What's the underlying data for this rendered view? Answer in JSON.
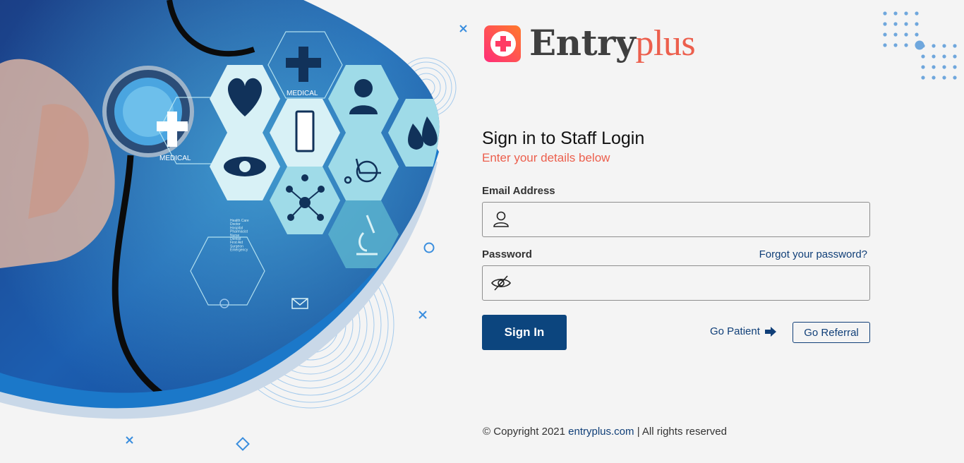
{
  "brand": {
    "name_part1": "Entry",
    "name_part2": "plus",
    "colors": {
      "primary": "#0c457e",
      "accent": "#ec5f4d",
      "logo_gradient": [
        "#ff2d7a",
        "#ff7a2b"
      ]
    }
  },
  "hero": {
    "hex_labels": {
      "medical_top": "MEDICAL",
      "medical_left": "MEDICAL"
    },
    "hex_list_items": [
      "Health Care",
      "Doctor",
      "Hospital",
      "Pharmacist",
      "Nurse",
      "Dentist",
      "First Aid",
      "Surgeon",
      "Emergency"
    ],
    "icons": [
      "stethoscope",
      "medical-cross-icon",
      "heart-icon",
      "doctor-icon",
      "drops-icon",
      "clipboard-icon",
      "eye-icon",
      "molecule-icon",
      "wheelchair-icon",
      "microscope-icon",
      "power-icon",
      "mail-icon"
    ]
  },
  "form": {
    "title": "Sign in to Staff Login",
    "subtitle": "Enter your details below",
    "email": {
      "label": "Email Address",
      "placeholder": "",
      "value": "",
      "icon": "user-icon"
    },
    "password": {
      "label": "Password",
      "placeholder": "",
      "value": "",
      "icon": "eye-slash-icon"
    },
    "forgot_link": "Forgot your password?",
    "signin_button": "Sign In",
    "go_patient_link": "Go Patient",
    "go_patient_icon": "arrow-right-icon",
    "go_referral_button": "Go Referral"
  },
  "footer": {
    "copyright_symbol": "©",
    "copyright_prefix": "Copyright 2021",
    "site_link": "entryplus.com",
    "suffix": "| All rights reserved"
  }
}
